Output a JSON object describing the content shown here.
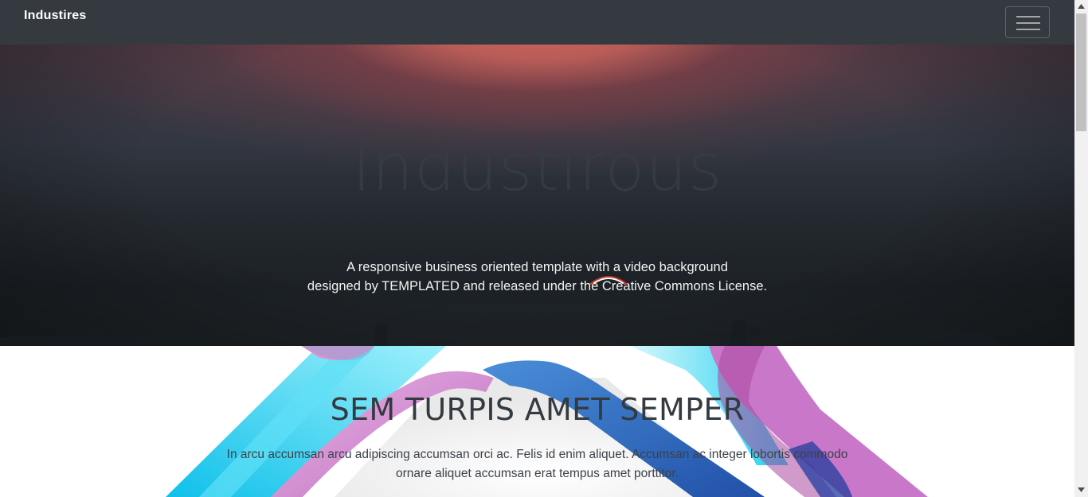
{
  "navbar": {
    "brand": "Industires",
    "menu_icon": "hamburger-menu-icon"
  },
  "hero": {
    "title": "Industirous",
    "subtitle_line1": "A responsive business oriented template with a video background",
    "subtitle_line2": "designed by TEMPLATED and released under the Creative Commons License.",
    "loading_icon": "loading-spinner-icon"
  },
  "section": {
    "title": "SEM TURPIS AMET SEMPER",
    "text_line1": "In arcu accumsan arcu adipiscing accumsan orci ac. Felis id enim aliquet. Accumsan ac integer lobortis commodo",
    "text_line2": "ornare aliquet accumsan erat tempus amet porttitor."
  },
  "colors": {
    "navbar_bg": "#343a40",
    "hero_glow": "#d4665c",
    "ribbon_cyan": "#16c8ec",
    "ribbon_blue": "#2f6fc4",
    "ribbon_pink": "#d58ad0",
    "ribbon_magenta": "#c86fc8"
  }
}
